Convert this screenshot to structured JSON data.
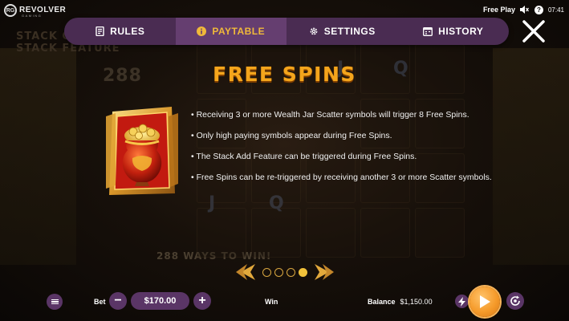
{
  "brand": {
    "name": "REVOLVER",
    "sub": "GAMING",
    "mark": "RG"
  },
  "status": {
    "mode": "Free Play",
    "time": "07:41",
    "help": "?"
  },
  "nav": {
    "tabs": [
      {
        "label": "RULES",
        "icon": "book-icon",
        "active": false
      },
      {
        "label": "PAYTABLE",
        "icon": "info-icon",
        "active": true
      },
      {
        "label": "SETTINGS",
        "icon": "gear-icon",
        "active": false
      },
      {
        "label": "HISTORY",
        "icon": "calendar-icon",
        "active": false
      }
    ]
  },
  "paytable": {
    "title": "FREE SPINS",
    "symbol": "wealth-jar-scatter-icon",
    "bullets": [
      "• Receiving 3 or more Wealth Jar Scatter symbols will trigger 8 Free Spins.",
      "• Only high paying symbols appear during Free Spins.",
      "• The Stack Add Feature can be triggered during Free Spins.",
      "• Free Spins can be re-triggered by receiving another 3 or more Scatter symbols."
    ]
  },
  "pager": {
    "pages": 4,
    "current": 4
  },
  "bottom": {
    "bet_label": "Bet",
    "bet_value": "$170.00",
    "win_label": "Win",
    "balance_label": "Balance",
    "balance_value": "$1,150.00",
    "minus": "−",
    "plus": "+"
  },
  "colors": {
    "accent": "#f0b93a",
    "nav_bg": "#4a2c52",
    "nav_active": "#653e70",
    "spin": "#f59a2a"
  }
}
